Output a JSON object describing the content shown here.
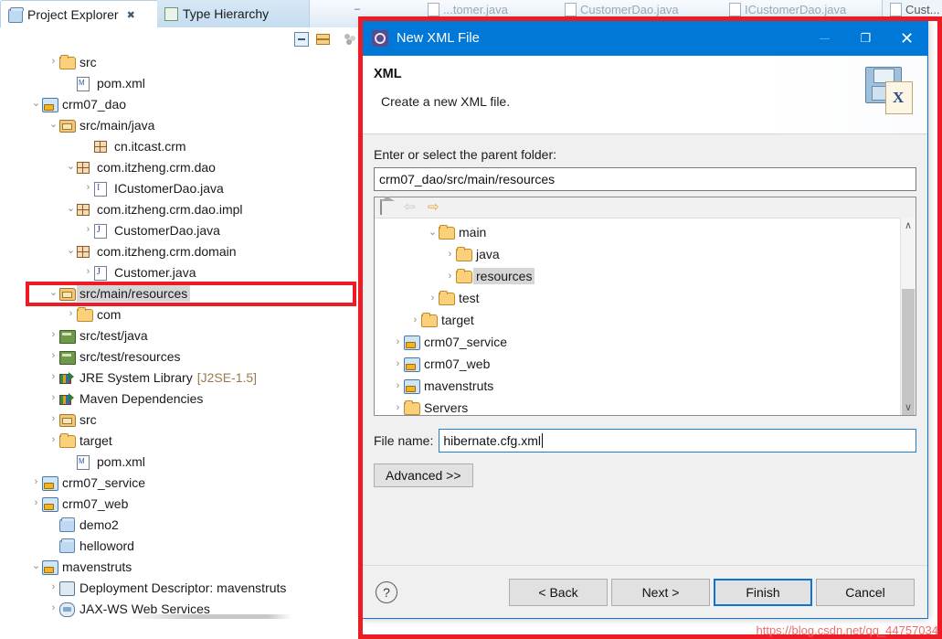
{
  "workbench": {
    "view_tabs": [
      {
        "label": "Project Explorer",
        "icon": "project-explorer-icon",
        "active": true,
        "close": "✖"
      },
      {
        "label": "Type Hierarchy",
        "icon": "type-hierarchy-icon",
        "active": false
      }
    ],
    "view_toolbar": [
      {
        "name": "collapse-all-icon"
      },
      {
        "name": "link-with-editor-icon"
      },
      {
        "name": "view-menu-icon"
      }
    ],
    "minimize_glyph": "–",
    "editor_tabs": [
      {
        "label": "...tomer.java"
      },
      {
        "label": "CustomerDao.java"
      },
      {
        "label": "ICustomerDao.java"
      },
      {
        "label": "Cust..."
      }
    ]
  },
  "project_tree": [
    {
      "indent": 2,
      "arrow": "›",
      "icon": "folder",
      "label": "src"
    },
    {
      "indent": 3,
      "arrow": "",
      "icon": "xml-file",
      "label": "pom.xml"
    },
    {
      "indent": 1,
      "arrow": "⌄",
      "icon": "maven-project",
      "label": "crm07_dao"
    },
    {
      "indent": 2,
      "arrow": "⌄",
      "icon": "source-folder",
      "label": "src/main/java"
    },
    {
      "indent": 4,
      "arrow": "",
      "icon": "package",
      "label": "cn.itcast.crm"
    },
    {
      "indent": 3,
      "arrow": "⌄",
      "icon": "package",
      "label": "com.itzheng.crm.dao"
    },
    {
      "indent": 4,
      "arrow": "›",
      "icon": "interface-file",
      "label": "ICustomerDao.java"
    },
    {
      "indent": 3,
      "arrow": "⌄",
      "icon": "package",
      "label": "com.itzheng.crm.dao.impl"
    },
    {
      "indent": 4,
      "arrow": "›",
      "icon": "java-file",
      "label": "CustomerDao.java"
    },
    {
      "indent": 3,
      "arrow": "⌄",
      "icon": "package",
      "label": "com.itzheng.crm.domain"
    },
    {
      "indent": 4,
      "arrow": "›",
      "icon": "java-file",
      "label": "Customer.java"
    },
    {
      "indent": 2,
      "arrow": "⌄",
      "icon": "source-folder",
      "label": "src/main/resources",
      "selected": true
    },
    {
      "indent": 3,
      "arrow": "›",
      "icon": "folder",
      "label": "com"
    },
    {
      "indent": 2,
      "arrow": "›",
      "icon": "package-root",
      "label": "src/test/java"
    },
    {
      "indent": 2,
      "arrow": "›",
      "icon": "package-root",
      "label": "src/test/resources"
    },
    {
      "indent": 2,
      "arrow": "›",
      "icon": "library",
      "label": "JRE System Library",
      "suffix": "[J2SE-1.5]"
    },
    {
      "indent": 2,
      "arrow": "›",
      "icon": "library",
      "label": "Maven Dependencies"
    },
    {
      "indent": 2,
      "arrow": "›",
      "icon": "source-folder",
      "label": "src"
    },
    {
      "indent": 2,
      "arrow": "›",
      "icon": "folder",
      "label": "target"
    },
    {
      "indent": 3,
      "arrow": "",
      "icon": "xml-file",
      "label": "pom.xml"
    },
    {
      "indent": 1,
      "arrow": "›",
      "icon": "maven-project",
      "label": "crm07_service"
    },
    {
      "indent": 1,
      "arrow": "›",
      "icon": "maven-project",
      "label": "crm07_web"
    },
    {
      "indent": 2,
      "arrow": "",
      "icon": "project",
      "label": "demo2"
    },
    {
      "indent": 2,
      "arrow": "",
      "icon": "project",
      "label": "helloword"
    },
    {
      "indent": 1,
      "arrow": "⌄",
      "icon": "maven-project",
      "label": "mavenstruts"
    },
    {
      "indent": 2,
      "arrow": "›",
      "icon": "web-descriptor",
      "label": "Deployment Descriptor: mavenstruts"
    },
    {
      "indent": 2,
      "arrow": "›",
      "icon": "web-service",
      "label": "JAX-WS Web Services"
    }
  ],
  "dialog": {
    "title": "New XML File",
    "title_icon": "wizard-gear-icon",
    "window_buttons": {
      "minimize": "─",
      "maximize": "❐",
      "close": "✕"
    },
    "header": {
      "heading": "XML",
      "description": "Create a new XML file.",
      "icon": "xml-file-wizard-icon"
    },
    "parent_folder": {
      "label": "Enter or select the parent folder:",
      "value": "crm07_dao/src/main/resources"
    },
    "folder_browser": {
      "toolbar": [
        {
          "name": "home-icon"
        },
        {
          "name": "back-arrow-icon"
        },
        {
          "name": "forward-arrow-icon"
        }
      ],
      "nodes": [
        {
          "indent": 3,
          "arrow": "⌄",
          "icon": "folder",
          "label": "main"
        },
        {
          "indent": 4,
          "arrow": "›",
          "icon": "folder",
          "label": "java"
        },
        {
          "indent": 4,
          "arrow": "›",
          "icon": "folder",
          "label": "resources",
          "selected": true
        },
        {
          "indent": 3,
          "arrow": "›",
          "icon": "folder",
          "label": "test"
        },
        {
          "indent": 2,
          "arrow": "›",
          "icon": "folder",
          "label": "target"
        },
        {
          "indent": 1,
          "arrow": "›",
          "icon": "maven-project",
          "label": "crm07_service"
        },
        {
          "indent": 1,
          "arrow": "›",
          "icon": "maven-project",
          "label": "crm07_web"
        },
        {
          "indent": 1,
          "arrow": "›",
          "icon": "maven-project",
          "label": "mavenstruts"
        },
        {
          "indent": 1,
          "arrow": "›",
          "icon": "folder",
          "label": "Servers"
        }
      ],
      "scroll_up": "∧",
      "scroll_down": "∨"
    },
    "file_name": {
      "label": "File name:",
      "value": "hibernate.cfg.xml"
    },
    "advanced_button": "Advanced >>",
    "footer": {
      "help": "?",
      "back": "< Back",
      "next": "Next >",
      "finish": "Finish",
      "cancel": "Cancel"
    }
  },
  "annotation": {
    "accent_color": "#ed1c24",
    "title_bar_color": "#0078d7"
  },
  "watermark": "https://blog.csdn.net/qq_44757034"
}
